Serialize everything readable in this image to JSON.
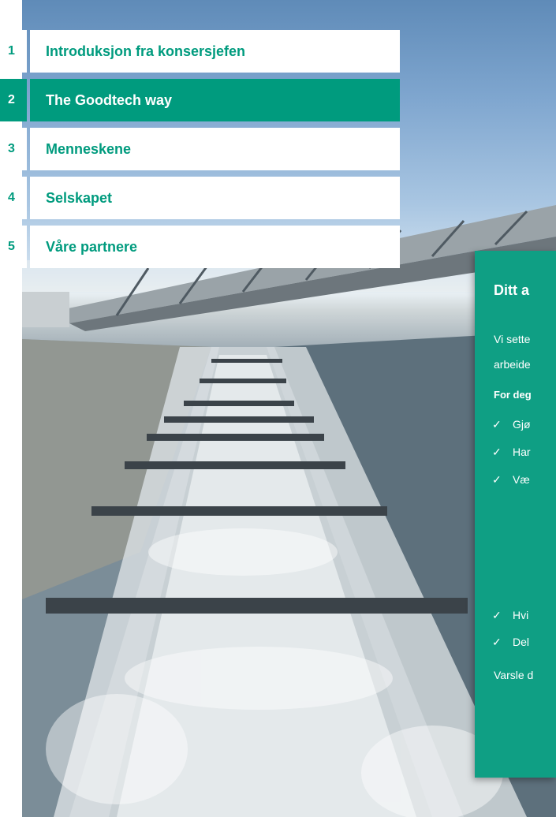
{
  "nav": {
    "items": [
      {
        "num": "1",
        "label": "Introduksjon fra konsersjefen",
        "active": false
      },
      {
        "num": "2",
        "label": "The Goodtech way",
        "active": true
      },
      {
        "num": "3",
        "label": "Menneskene",
        "active": false
      },
      {
        "num": "4",
        "label": "Selskapet",
        "active": false
      },
      {
        "num": "5",
        "label": "Våre partnere",
        "active": false
      }
    ]
  },
  "card": {
    "title": "Ditt a",
    "intro_line1": "Vi sette",
    "intro_line2": "arbeide",
    "subheading": "For deg",
    "checks_top": [
      "Gjø",
      "Har",
      "Væ"
    ],
    "checks_bottom": [
      "Hvi",
      "Del"
    ],
    "footer": "Varsle d"
  },
  "colors": {
    "accent": "#009b7e",
    "card": "#0f9f84"
  }
}
